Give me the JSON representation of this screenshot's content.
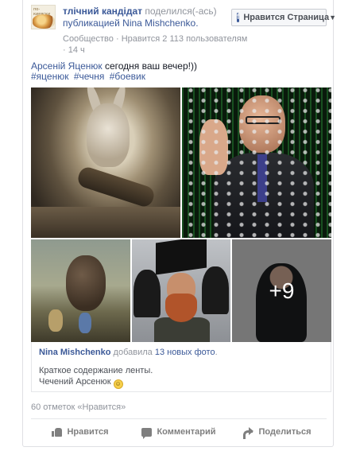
{
  "post": {
    "author": "тлічний кандідат",
    "shared_text": "поделился(-ась)",
    "publication_link": "публикацией Nina Mishchenko.",
    "community": "Сообщество",
    "community_likes": "Нравится 2 113 пользователям",
    "time": "14 ч",
    "avatar_caption": "по-киевски"
  },
  "page_like_button": {
    "label": "Нравится Страница",
    "icon": "facebook-f-icon"
  },
  "message": {
    "mention": "Арсеній Яценюк",
    "text": " сегодня ваш вечер!))",
    "hashtags": [
      "#яценюк",
      "#чечня",
      "#боевик"
    ]
  },
  "photos": {
    "more_count": "+9"
  },
  "shared_post": {
    "author": "Nina Mishchenko",
    "action": "добавила",
    "photos_link": "13 новых фото",
    "description_line1": "Краткое содержание ленты.",
    "description_line2": "Чечений Арсенюк",
    "emoji": "smile-emoji"
  },
  "footer": {
    "likes_count": "60 отметок «Нравится»",
    "actions": {
      "like": "Нравится",
      "comment": "Комментарий",
      "share": "Поделиться"
    }
  }
}
